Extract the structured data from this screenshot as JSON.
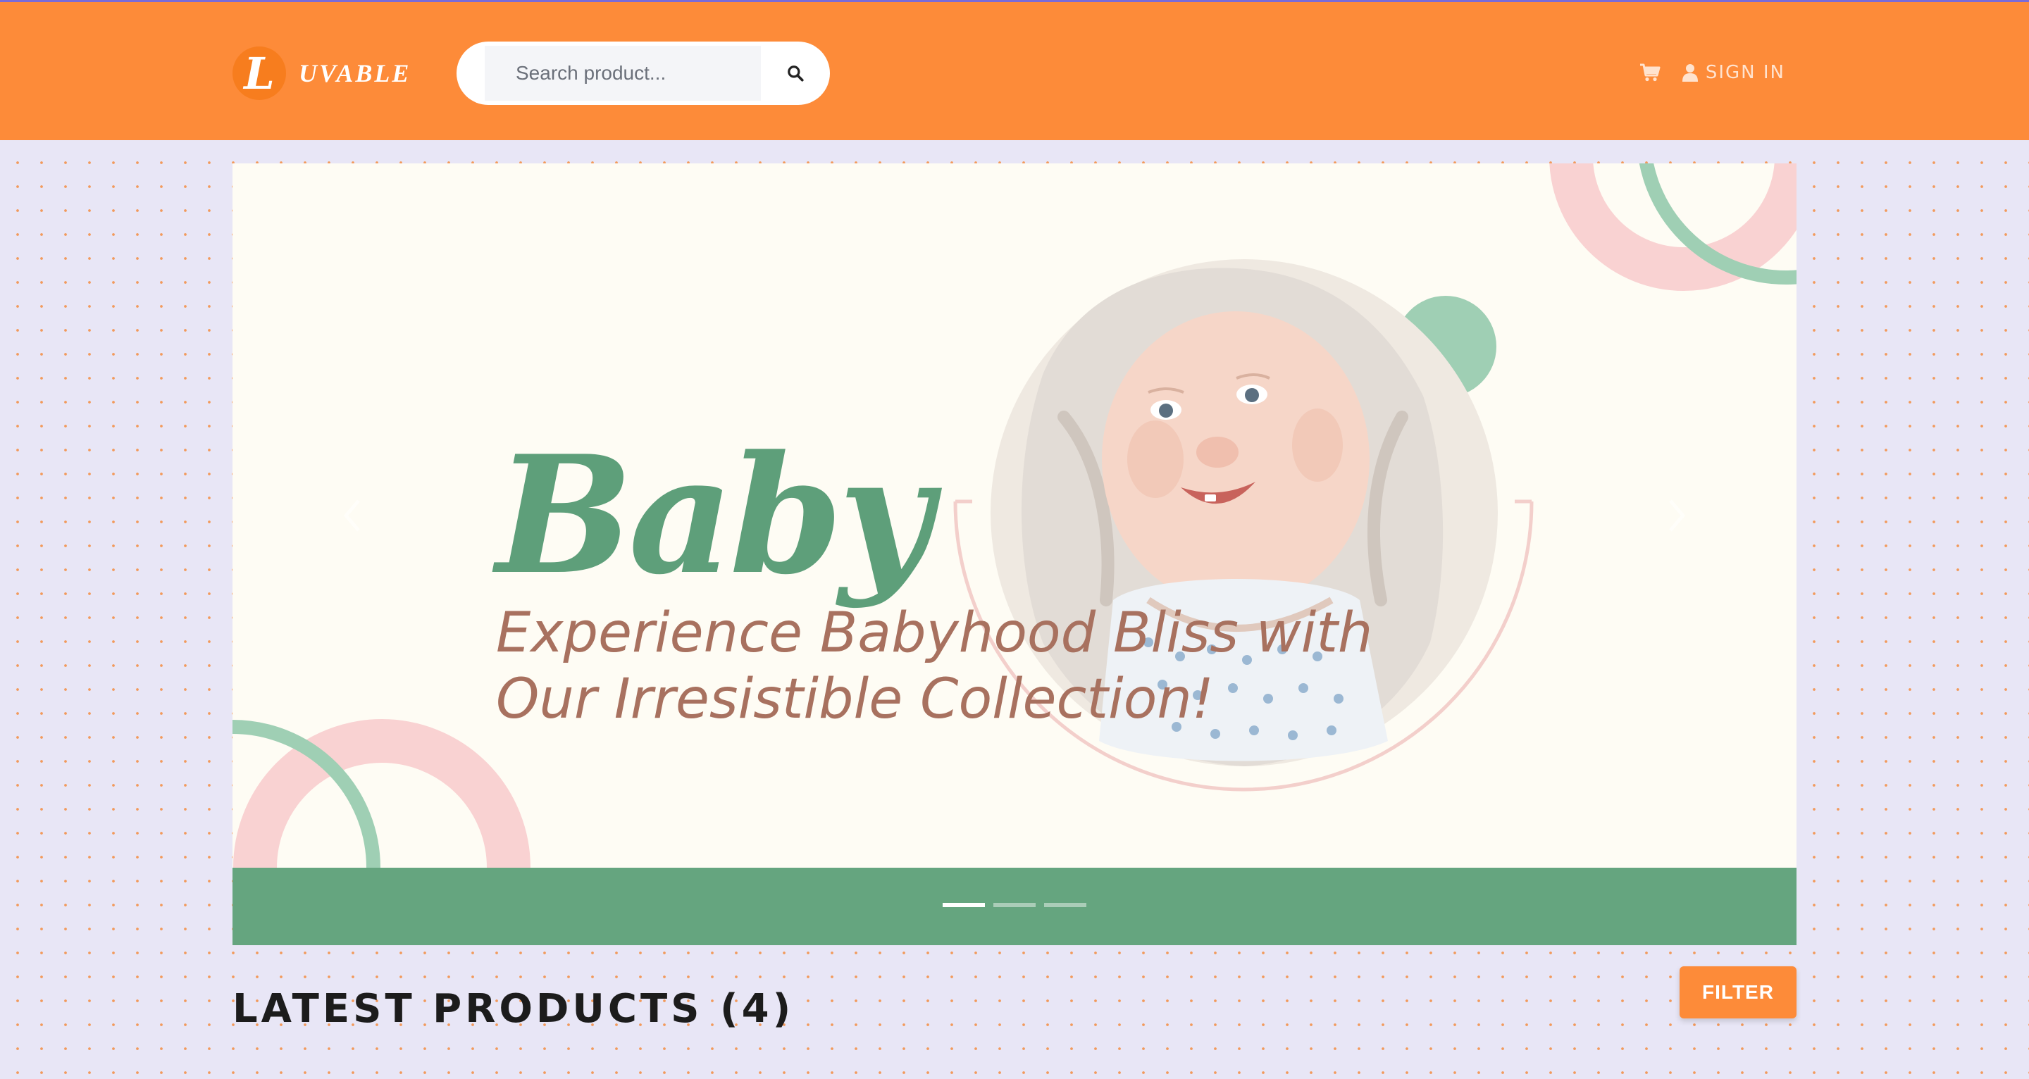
{
  "navbar": {
    "brand_initial": "L",
    "brand_name": "UVABLE",
    "search": {
      "placeholder": "Search product..."
    },
    "search_icon": "search-icon",
    "cart_icon": "cart-icon",
    "user_icon": "user-icon",
    "signin_label": "SIGN IN"
  },
  "carousel": {
    "headline": "Baby",
    "tagline_line1": "Experience Babyhood Bliss with",
    "tagline_line2": "Our Irresistible Collection!",
    "slides_count": 3,
    "active_slide": 1,
    "prev_icon": "chevron-left-icon",
    "next_icon": "chevron-right-icon"
  },
  "products": {
    "section_title": "LATEST PRODUCTS (4)",
    "filter_label": "FILTER"
  },
  "colors": {
    "navbar": "#fd8b39",
    "brand_badge": "#f77d1e",
    "banner_bg": "#fefcf4",
    "banner_band": "#65a57f",
    "headline": "#5e9f7a",
    "tagline": "#a8715f",
    "ring_pink": "#f9d2d2",
    "ring_green": "#9fcfb4",
    "page_bg": "#e8e6f6"
  }
}
